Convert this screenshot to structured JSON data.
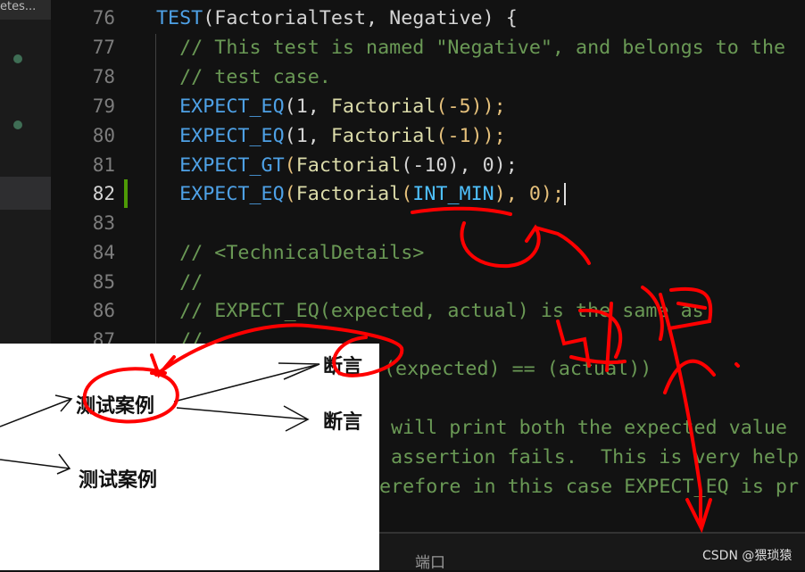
{
  "sidebar": {
    "tab_label": "etes..."
  },
  "editor": {
    "current_line": 82,
    "lines": [
      {
        "n": "76"
      },
      {
        "n": "77"
      },
      {
        "n": "78"
      },
      {
        "n": "79"
      },
      {
        "n": "80"
      },
      {
        "n": "81"
      },
      {
        "n": "82"
      },
      {
        "n": "83"
      },
      {
        "n": "84"
      },
      {
        "n": "85"
      },
      {
        "n": "86"
      },
      {
        "n": "87"
      }
    ],
    "code": {
      "l76a": "TEST",
      "l76b": "(FactorialTest, Negative) {",
      "l77": "  // This test is named \"Negative\", and belongs to the",
      "l78": "  // test case.",
      "l79a": "  EXPECT_EQ",
      "l79b": "(1, ",
      "l79c": "Factorial",
      "l79d": "(-5));",
      "l80a": "  EXPECT_EQ",
      "l80b": "(1, ",
      "l80c": "Factorial",
      "l80d": "(-1));",
      "l81a": "  EXPECT_GT",
      "l81b": "(",
      "l81c": "Factorial",
      "l81d": "(-10), 0);",
      "l82a": "  EXPECT_EQ",
      "l82b": "(",
      "l82c": "Factorial",
      "l82d": "(",
      "l82e": "INT_MIN",
      "l82f": "), 0);",
      "l84": "  // <TechnicalDetails>",
      "l85": "  //",
      "l86": "  // EXPECT_EQ(expected, actual) is the same as",
      "l87": "  //",
      "l88": "(expected) == (actual))",
      "l90": "will print both the expected value",
      "l91": "assertion fails.  This is very help",
      "l92": "erefore in this case EXPECT_EQ is pr"
    }
  },
  "panel": {
    "port_label": "端口"
  },
  "watermark": "CSDN @猥琐猿",
  "diagram": {
    "case1": "测试案例",
    "case2": "测试案例",
    "assert1": "断言",
    "assert2": "断言"
  },
  "colors": {
    "annotation": "#ff0000",
    "keyword": "#4ea1e6",
    "comment": "#6a9955",
    "gutter_change": "#4e9a06"
  }
}
